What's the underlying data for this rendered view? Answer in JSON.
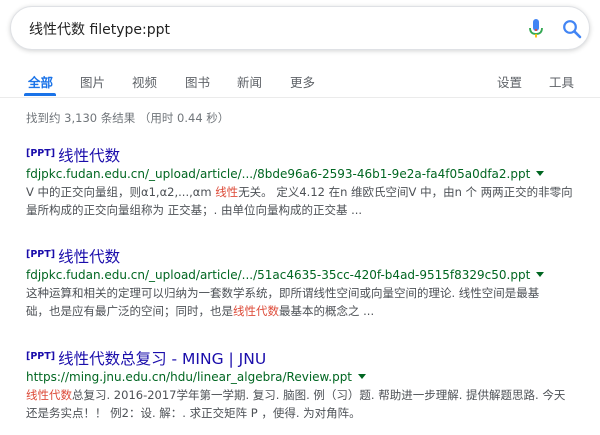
{
  "search": {
    "query": "线性代数 filetype:ppt"
  },
  "tabs": [
    {
      "label": "全部",
      "active": true
    },
    {
      "label": "图片"
    },
    {
      "label": "视频"
    },
    {
      "label": "图书"
    },
    {
      "label": "新闻"
    },
    {
      "label": "更多"
    },
    {
      "label": "设置"
    },
    {
      "label": "工具"
    }
  ],
  "result_stats": "找到约 3,130 条结果 （用时 0.44 秒）",
  "results": [
    {
      "tag": "[PPT]",
      "title": "线性代数",
      "url": "fdjpkc.fudan.edu.cn/_upload/article/.../8bde96a6-2593-46b1-9e2a-fa4f05a0dfa2.ppt",
      "snippet": {
        "line1_pre": "V 中的正交向量组，则α1,α2,...,αm ",
        "line1_hl": "线性",
        "line1_post": "无关。 定义4.12 在n 维欧氏空间V 中，由n 个 两两正交的非零向",
        "line2": "量所构成的正交向量组称为 正交基；. 由单位向量构成的正交基 ..."
      }
    },
    {
      "tag": "[PPT]",
      "title": "线性代数",
      "url": "fdjpkc.fudan.edu.cn/_upload/article/.../51ac4635-35cc-420f-b4ad-9515f8329c50.ppt",
      "snippet": {
        "line1": "这种运算和相关的定理可以归纳为一套数学系统，即所谓线性空间或向量空间的理论. 线性空间是最基",
        "line2_pre": "础，也是应有最广泛的空间；同时，也是",
        "line2_hl": "线性代数",
        "line2_post": "最基本的概念之 ..."
      }
    },
    {
      "tag": "[PPT]",
      "title": "线性代数总复习 - MING | JNU",
      "url": "https://ming.jnu.edu.cn/hdu/linear_algebra/Review.ppt",
      "snippet": {
        "line1_hl": "线性代数",
        "line1_post": "总复习. 2016-2017学年第一学期. 复习. 脑图. 例（习）题. 帮助进一步理解. 提供解题思路. 今天",
        "line2": "还是务实点！！ 例2：设. 解：. 求正交矩阵 P ，使得. 为对角阵。"
      }
    }
  ]
}
